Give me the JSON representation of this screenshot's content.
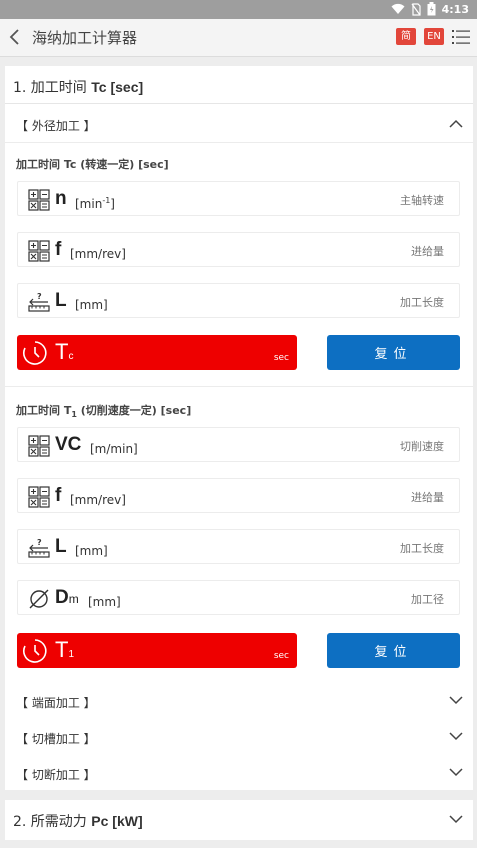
{
  "status": {
    "time": "4:13"
  },
  "appbar": {
    "title": "海纳加工计算器",
    "lang_zh": "简",
    "lang_en": "EN"
  },
  "section1": {
    "title_prefix": "1. 加工时间 ",
    "title_sym": "Tc [sec]",
    "outer": {
      "label": "【 外径加工 】",
      "tc": {
        "caption": "加工时间 Tc (转速一定) [sec]",
        "fields": [
          {
            "sym": "n",
            "unit": "[min",
            "unit_sup": "-1",
            "unit_end": "]",
            "placeholder": "主轴转速"
          },
          {
            "sym": "f",
            "unit": "[mm/rev]",
            "placeholder": "进给量"
          },
          {
            "sym": "L",
            "unit": "[mm]",
            "placeholder": "加工长度"
          }
        ],
        "result_sym": "T",
        "result_sub": "c",
        "result_unit": "sec",
        "reset": "复位"
      },
      "t1": {
        "caption_a": "加工时间 T",
        "caption_sub": "1",
        "caption_b": " (切削速度一定) [sec]",
        "fields": [
          {
            "sym": "VC",
            "unit": "[m/min]",
            "placeholder": "切削速度"
          },
          {
            "sym": "f",
            "unit": "[mm/rev]",
            "placeholder": "进给量"
          },
          {
            "sym": "L",
            "unit": "[mm]",
            "placeholder": "加工长度"
          },
          {
            "sym": "D",
            "sym_sub": "m",
            "unit": "[mm]",
            "placeholder": "加工径"
          }
        ],
        "result_sym": "T",
        "result_sub": "1",
        "result_unit": "sec",
        "reset": "复位"
      }
    },
    "collapsed": [
      "【 端面加工 】",
      "【 切槽加工 】",
      "【 切断加工 】"
    ]
  },
  "section2": {
    "title_prefix": "2. 所需动力 ",
    "title_sym": "Pc [kW]"
  },
  "colors": {
    "accent_red": "#ee0000",
    "reset_blue": "#0d6fc2",
    "lang_red": "#e2463a"
  }
}
